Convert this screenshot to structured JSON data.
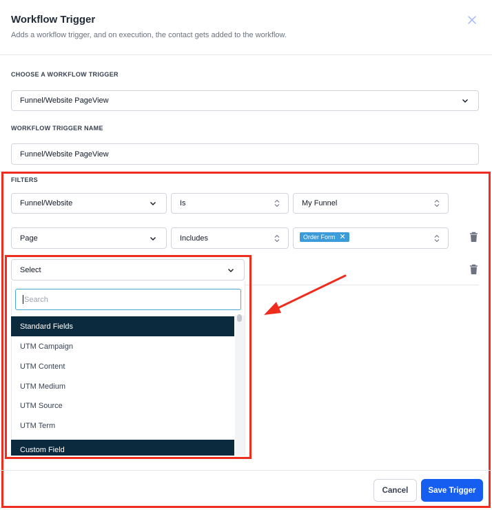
{
  "modal": {
    "title": "Workflow Trigger",
    "subtitle": "Adds a workflow trigger, and on execution, the contact gets added to the workflow."
  },
  "trigger": {
    "choose_label": "CHOOSE A WORKFLOW TRIGGER",
    "choose_value": "Funnel/Website PageView",
    "name_label": "WORKFLOW TRIGGER NAME",
    "name_value": "Funnel/Website PageView"
  },
  "filters": {
    "label": "FILTERS",
    "rows": [
      {
        "field": "Funnel/Website",
        "operator": "Is",
        "value": "My Funnel"
      },
      {
        "field": "Page",
        "operator": "Includes",
        "tag": "Order Form"
      }
    ],
    "new_row": {
      "field": "Select"
    }
  },
  "dropdown": {
    "search_placeholder": "Search",
    "options": [
      {
        "label": "Standard Fields",
        "group": true
      },
      {
        "label": "UTM Campaign",
        "group": false
      },
      {
        "label": "UTM Content",
        "group": false
      },
      {
        "label": "UTM Medium",
        "group": false
      },
      {
        "label": "UTM Source",
        "group": false
      },
      {
        "label": "UTM Term",
        "group": false
      },
      {
        "label": "Custom Field",
        "group": true
      }
    ]
  },
  "footer": {
    "cancel_label": "Cancel",
    "save_label": "Save Trigger"
  },
  "colors": {
    "primary": "#155eef",
    "annotation": "#ef2d1f",
    "group_header": "#0c2a3d",
    "tag": "#3b9cd9"
  }
}
